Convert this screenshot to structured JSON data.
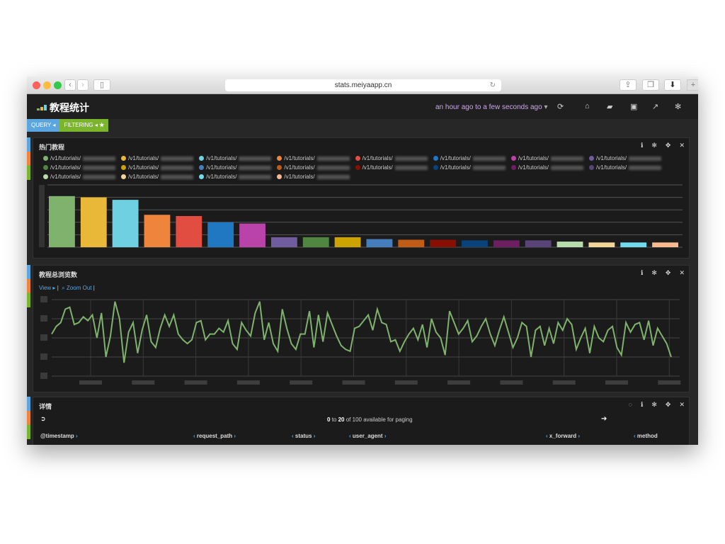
{
  "browser": {
    "url": "stats.meiyaapp.cn"
  },
  "nav": {
    "title": "教程统计",
    "time_range": "an hour ago to a few seconds ago"
  },
  "filters": {
    "query": "QUERY",
    "filtering": "FILTERING"
  },
  "panels": {
    "top": {
      "title": "热门教程",
      "legend_prefix": "/v1/tutorials/"
    },
    "views": {
      "title": "教程总浏览数",
      "view": "View",
      "zoom_out": "Zoom Out"
    },
    "details": {
      "title": "详情",
      "paging_from": "0",
      "paging_to": "20",
      "paging_text_to": "to",
      "paging_rest": "of 100 available for paging",
      "columns": [
        "@timestamp",
        "request_path",
        "status",
        "user_agent",
        "x_forward",
        "method"
      ]
    }
  },
  "chart_data": [
    {
      "type": "bar",
      "title": "热门教程",
      "colors": [
        "#7EB26D",
        "#EAB839",
        "#6ED0E0",
        "#EF843C",
        "#E24D42",
        "#1F78C1",
        "#BA43A9",
        "#705DA0",
        "#508642",
        "#CCA300",
        "#447EBC",
        "#C15C17",
        "#890F02",
        "#0A437C",
        "#6D1F62",
        "#584477",
        "#B7DBAB",
        "#F4D598",
        "#70DBED",
        "#F9BA8F"
      ],
      "values": [
        4.1,
        4.0,
        3.8,
        2.6,
        2.5,
        2.0,
        1.9,
        0.8,
        0.8,
        0.8,
        0.65,
        0.6,
        0.6,
        0.55,
        0.55,
        0.55,
        0.45,
        0.38,
        0.38,
        0.38
      ],
      "ylim": [
        0,
        5
      ],
      "grid": true
    },
    {
      "type": "line",
      "title": "教程总浏览数",
      "color": "#7EB26D",
      "ylim": [
        0,
        4
      ],
      "grid": true,
      "values": [
        2.2,
        2.6,
        2.8,
        3.5,
        3.6,
        2.7,
        2.8,
        3.1,
        2.9,
        3.2,
        2.0,
        3.3,
        1.0,
        2.1,
        3.9,
        3.0,
        0.7,
        2.3,
        2.8,
        1.2,
        2.4,
        3.2,
        1.8,
        1.5,
        2.5,
        3.2,
        2.6,
        3.2,
        2.2,
        1.9,
        1.7,
        1.9,
        2.8,
        2.9,
        1.9,
        2.2,
        2.2,
        2.5,
        2.3,
        2.9,
        1.7,
        1.4,
        2.8,
        2.4,
        2.1,
        3.3,
        3.9,
        1.9,
        2.8,
        1.7,
        1.3,
        3.5,
        2.5,
        1.7,
        1.4,
        2.2,
        2.2,
        3.4,
        1.5,
        3.2,
        1.8,
        3.3,
        2.7,
        2.1,
        1.6,
        1.4,
        1.3,
        2.5,
        2.6,
        2.9,
        3.2,
        2.4,
        3.5,
        2.8,
        2.7,
        1.8,
        1.9,
        1.3,
        1.8,
        2.2,
        2.5,
        1.9,
        2.7,
        1.5,
        3.0,
        2.3,
        2.0,
        1.1,
        3.4,
        2.8,
        2.2,
        2.5,
        2.9,
        1.8,
        2.1,
        2.6,
        3.0,
        2.2,
        1.6,
        2.4,
        3.1,
        2.3,
        1.5,
        2.0,
        2.8,
        2.6,
        1.0,
        2.4,
        2.6,
        1.6,
        2.5,
        1.7,
        2.8,
        2.4,
        3.0,
        2.7,
        1.4,
        2.0,
        2.5,
        1.2,
        2.6,
        2.0,
        1.8,
        2.4,
        2.6,
        1.5,
        1.1,
        2.8,
        2.3,
        2.7,
        2.8,
        1.9,
        2.9,
        1.6,
        2.5,
        2.1,
        1.7,
        1.0
      ]
    }
  ]
}
